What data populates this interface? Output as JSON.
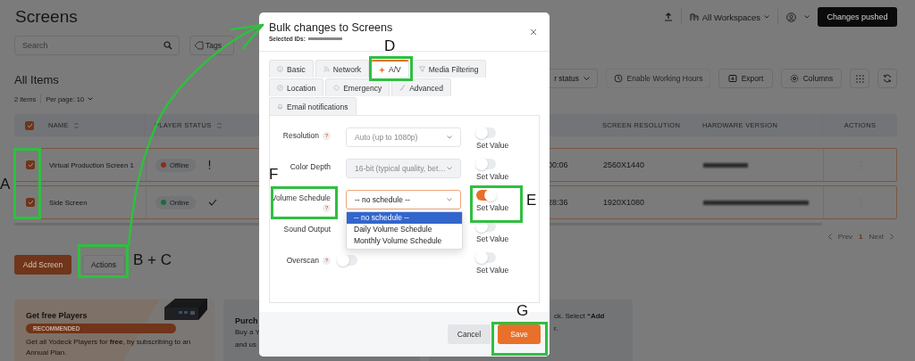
{
  "header": {
    "title": "Screens",
    "workspace": "All Workspaces",
    "push_button": "Changes pushed"
  },
  "filters": {
    "search_placeholder": "Search",
    "tags": "Tags"
  },
  "list": {
    "title": "All Items",
    "count": "2 items",
    "per_page": "Per page: 10"
  },
  "toolbar": [
    {
      "label": "r status",
      "kind": "dropdown",
      "disabled": false
    },
    {
      "label": "Enable Working Hours",
      "kind": "button",
      "disabled": true
    },
    {
      "label": "Export",
      "kind": "button",
      "disabled": false
    },
    {
      "label": "Columns",
      "kind": "button",
      "disabled": false
    }
  ],
  "table": {
    "all_selected": true,
    "columns": [
      "NAME",
      "PLAYER STATUS",
      "SCREEN RESOLUTION",
      "HARDWARE VERSION",
      "ACTIONS"
    ],
    "rows": [
      {
        "selected": true,
        "name": "Virtual Production Screen 1",
        "status": "Offline",
        "color": "#8a2e1e",
        "online": false,
        "column_4": "00:06",
        "resolution": "2560X1440"
      },
      {
        "selected": true,
        "name": "Side Screen",
        "status": "Online",
        "color": "#1f6b3e",
        "online": true,
        "column_4": "28:36",
        "resolution": "1920X1080"
      }
    ]
  },
  "pagination": {
    "prev": "Prev",
    "page": "1",
    "next": "Next"
  },
  "buttons": {
    "add": "Add Screen",
    "actions": "Actions"
  },
  "cards": [
    {
      "title": "Get free Players",
      "badge": "RECOMMENDED",
      "text": "Get all Yodeck Players for **free**, by subscribing to an Annual Plan."
    },
    {
      "title": "Purch",
      "lines": [
        "Buy a Y",
        "and us"
      ]
    },
    {
      "lines": [
        "ck. Select **“Add**",
        "r."
      ]
    }
  ],
  "modal": {
    "title": "Bulk changes to Screens",
    "subtitle": "Selected IDs:",
    "tab_rows": [
      [
        {
          "label": "Basic",
          "selected": false
        },
        {
          "label": "Network",
          "selected": false
        },
        {
          "label": "A/V",
          "selected": true
        },
        {
          "label": "Media Filtering",
          "selected": false
        }
      ],
      [
        {
          "label": "Location",
          "selected": false
        },
        {
          "label": "Emergency",
          "selected": false
        },
        {
          "label": "Advanced",
          "selected": false
        }
      ],
      [
        {
          "label": "Email notifications",
          "selected": false
        }
      ]
    ],
    "rows": [
      {
        "label": "Resolution",
        "help": "?",
        "field": {
          "kind": "select",
          "value": "Auto (up to 1080p)",
          "disabled": false,
          "expanded": false
        },
        "set_value": false,
        "set_label": "Set Value"
      },
      {
        "label": "Color Depth",
        "field": {
          "kind": "select",
          "value": "16-bit (typical quality, bet…",
          "disabled": true,
          "expanded": false
        },
        "set_value": false,
        "set_label": "Set Value"
      },
      {
        "label": "Volume Schedule",
        "help": "?",
        "field": {
          "kind": "select",
          "value": "-- no schedule --",
          "disabled": false,
          "expanded": true,
          "options": [
            {
              "label": "-- no schedule --",
              "selected": true
            },
            {
              "label": "Daily Volume Schedule",
              "selected": false
            },
            {
              "label": "Monthly Volume Schedule",
              "selected": false
            }
          ]
        },
        "set_value": true,
        "set_label": "Set Value"
      },
      {
        "label": "Sound Output",
        "set_value": false,
        "set_label": "Set Value"
      },
      {
        "label": "Overscan",
        "help": "?",
        "field": {
          "kind": "toggle",
          "on": false
        },
        "set_value": false,
        "set_label": "Set Value"
      }
    ],
    "cancel": "Cancel",
    "save": "Save"
  },
  "annotations": [
    {
      "label": "A"
    },
    {
      "label": "B + C"
    },
    {
      "label": "D"
    },
    {
      "label": "E"
    },
    {
      "label": "F"
    },
    {
      "label": "G"
    }
  ]
}
